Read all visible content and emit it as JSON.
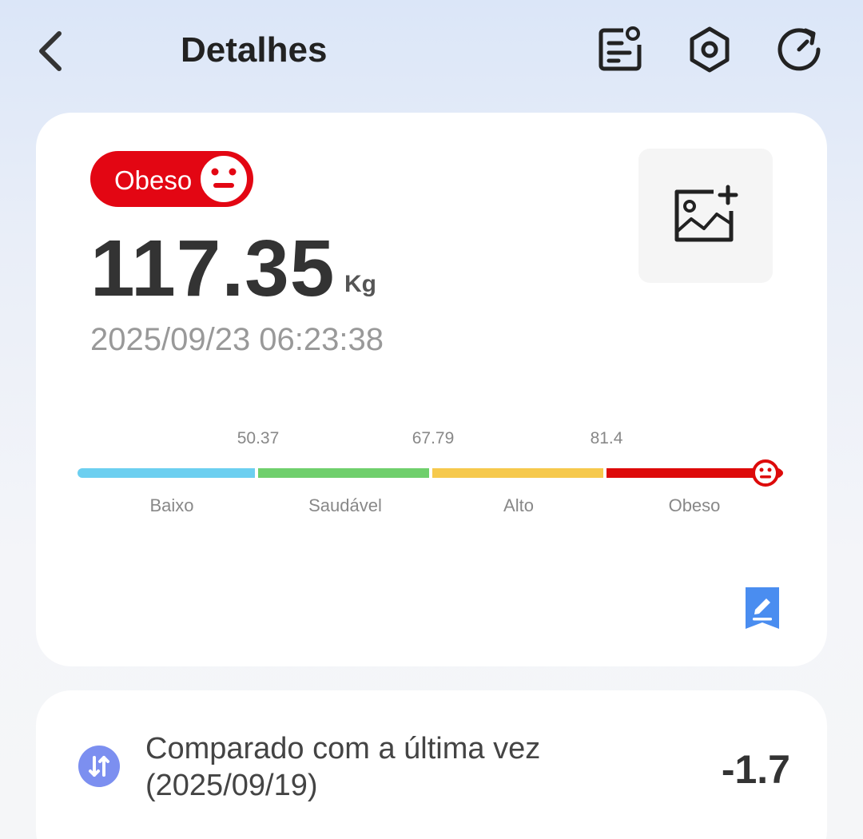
{
  "header": {
    "title": "Detalhes",
    "icons": [
      "back-arrow-icon",
      "notes-icon",
      "settings-hexagon-icon",
      "refresh-icon"
    ]
  },
  "summary": {
    "status_label": "Obeso",
    "status_color": "#e30613",
    "weight_value": "117.35",
    "weight_unit": "Kg",
    "datetime": "2025/09/23 06:23:38"
  },
  "scale": {
    "thresholds": [
      "50.37",
      "67.79",
      "81.4"
    ],
    "segments": [
      {
        "label": "Baixo",
        "color": "#6ccff0"
      },
      {
        "label": "Saudável",
        "color": "#6fcf6c"
      },
      {
        "label": "Alto",
        "color": "#f6c94d"
      },
      {
        "label": "Obeso",
        "color": "#dd0a0a"
      }
    ],
    "marker_icon": "neutral-face-icon",
    "marker_position": "end of Obeso range"
  },
  "comparison": {
    "label": "Comparado com a última vez",
    "date": "(2025/09/19)",
    "value": "-1.7",
    "icon": "swap-arrows-icon",
    "icon_color": "#7c8ff0"
  }
}
